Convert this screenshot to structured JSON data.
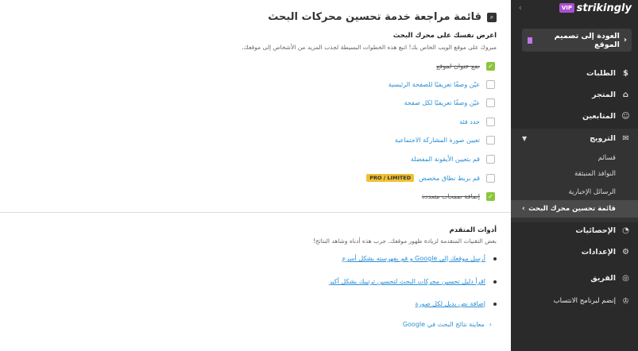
{
  "sidebar": {
    "brand": "strikingly",
    "vip_badge": "VIP",
    "back_label": "العودة إلى تصميم الموقع",
    "items": [
      {
        "label": "الطلبات",
        "icon": "dollar-icon"
      },
      {
        "label": "المتجر",
        "icon": "shop-icon"
      },
      {
        "label": "المتابعين",
        "icon": "people-icon"
      },
      {
        "label": "الترويج",
        "icon": "megaphone-icon"
      },
      {
        "label": "الإحصائيات",
        "icon": "stats-icon"
      },
      {
        "label": "الإعدادات",
        "icon": "gear-icon"
      },
      {
        "label": "الفريق",
        "icon": "team-icon"
      },
      {
        "label": "إنضم لبرنامج الانتساب",
        "icon": "trophy-icon"
      }
    ],
    "promo_sub": [
      "قسائم",
      "النوافذ المنبثقة",
      "الرسائل الإخبارية",
      "قائمة تحسين محرك البحث"
    ]
  },
  "main": {
    "title": "قائمة مراجعة خدمة تحسين محركات البحث",
    "section1": {
      "heading": "اعرض نفسك على محرك البحث",
      "desc": "مبروك على موقع الويب الخاص بك! اتبع هذه الخطوات البسيطة لجذب المزيد من الأشخاص إلى موقعك."
    },
    "tasks": [
      {
        "label": "ضع عنوان لموقع",
        "done": true
      },
      {
        "label": "عيّن وصفًا تعريفيًا للصفحة الرئيسية",
        "done": false
      },
      {
        "label": "عيّن وصفًا تعريفيًا لكل صفحة",
        "done": false
      },
      {
        "label": "حدد فئة",
        "done": false
      },
      {
        "label": "تعيين صورة المشاركة الاجتماعية",
        "done": false
      },
      {
        "label": "قم بتعيين الأيقونة المفضلة",
        "done": false
      },
      {
        "label": "قم بربط نطاق مخصص",
        "done": false,
        "badge": "PRO / LIMITED"
      },
      {
        "label": "إضافة صفحات متعددة",
        "done": true
      }
    ],
    "section2": {
      "heading": "أدوات المتقدم",
      "desc": "بعض التقنيات المتقدمة لزيادة ظهور موقعك. جرب هذه أدناه وشاهد النتائج!"
    },
    "advanced": [
      "أرسل موقعك إلى Google و قم بفهرسته بشكل أسرع",
      "اقرأ دليل تحسين محركات البحث لتحسين ترتيبك بشكل أكبر",
      "إضافة نص بديل لكل صورة"
    ],
    "preview_link": "معاينة نتائج البحث في Google"
  },
  "colors": {
    "sidebar_bg": "#2a2a2a",
    "accent_link": "#2a8fd6",
    "check_green": "#8bc53f",
    "pro_badge": "#f0c132",
    "vip": "#a84fd1"
  }
}
